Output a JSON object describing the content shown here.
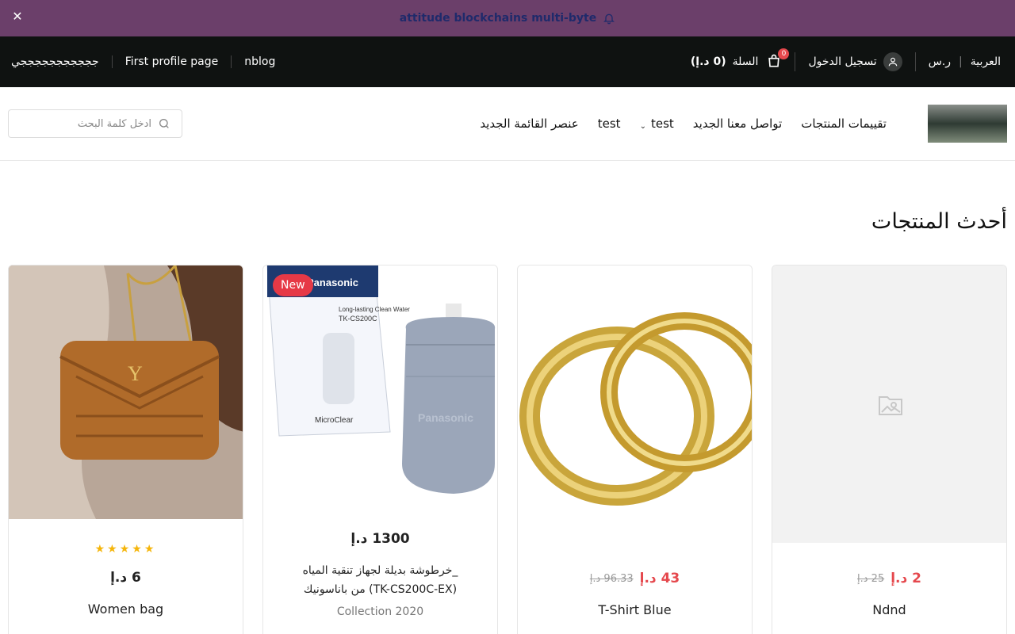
{
  "announcement": {
    "text": "attitude blockchains multi-byte",
    "close_icon": "close-icon",
    "bell_icon": "bell-icon"
  },
  "topbar": {
    "left_links": [
      "nblog",
      "First profile page",
      "جججججججججججي"
    ],
    "language": "العربية",
    "currency": "ر.س",
    "login": "تسجيل الدخول",
    "cart": {
      "label": "السلة",
      "amount": "(0 د.إ)",
      "count": "0"
    }
  },
  "nav": {
    "items": [
      {
        "label": "تقييمات المنتجات",
        "has_dropdown": false
      },
      {
        "label": "تواصل معنا الجديد",
        "has_dropdown": false
      },
      {
        "label": "test",
        "has_dropdown": true
      },
      {
        "label": "test",
        "has_dropdown": false
      },
      {
        "label": "عنصر القائمة الجديد",
        "has_dropdown": false
      }
    ],
    "search_placeholder": "ادخل كلمة البحث"
  },
  "section": {
    "title": "أحدث المنتجات"
  },
  "products": [
    {
      "name": "Ndnd",
      "price": "2 د.إ",
      "old_price": "25 د.إ"
    },
    {
      "name": "T-Shirt Blue",
      "price": "43 د.إ",
      "old_price": "96.33 د.إ"
    },
    {
      "name_line1": "_خرطوشة بديلة لجهاز تنقية المياه",
      "name_line2": "(TK-CS200C-EX) من باناسونيك",
      "price": "1300 د.إ",
      "collection": "Collection 2020",
      "badge": "New",
      "box_brand": "Panasonic",
      "box_model": "TK-CS200C",
      "box_type": "Long-lasting Clean Water",
      "box_subbrand": "MicroClear",
      "cartridge_brand": "Panasonic"
    },
    {
      "name": "Women bag",
      "price": "6 د.إ",
      "rating": 5
    }
  ],
  "colors": {
    "accent": "#e5484d",
    "announce_bg": "#6b3f6a",
    "topbar_bg": "#0f1211",
    "stars": "#f5b50a"
  }
}
